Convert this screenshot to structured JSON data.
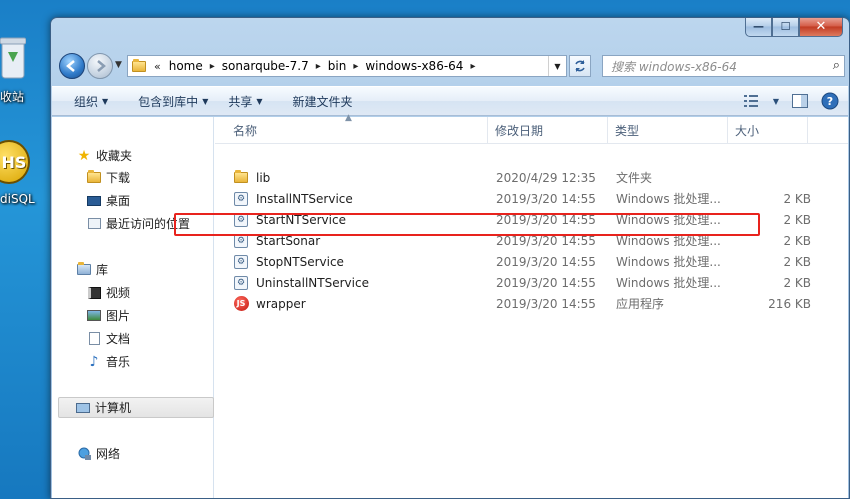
{
  "desktop": {
    "icon1_label": "收站",
    "icon2_label": "diSQL",
    "icon2_badge": "HS"
  },
  "window": {
    "caption_min": "—",
    "caption_max": "☐",
    "caption_close": "✕"
  },
  "address": {
    "crumbs": [
      "home",
      "sonarqube-7.7",
      "bin",
      "windows-x86-64"
    ],
    "chevron": "«"
  },
  "search": {
    "placeholder": "搜索 windows-x86-64"
  },
  "toolbar": {
    "organize": "组织",
    "include_library": "包含到库中",
    "share": "共享",
    "new_folder": "新建文件夹"
  },
  "nav_pane": {
    "favorites": "收藏夹",
    "downloads": "下载",
    "desktop": "桌面",
    "recent": "最近访问的位置",
    "libraries": "库",
    "videos": "视频",
    "pictures": "图片",
    "documents": "文档",
    "music": "音乐",
    "computer": "计算机",
    "network": "网络"
  },
  "columns": {
    "name": "名称",
    "date": "修改日期",
    "type": "类型",
    "size": "大小"
  },
  "files": [
    {
      "name": "lib",
      "date": "2020/4/29 12:35",
      "type": "文件夹",
      "size": "",
      "icon": "folder-icon"
    },
    {
      "name": "InstallNTService",
      "date": "2019/3/20 14:55",
      "type": "Windows 批处理...",
      "size": "2 KB",
      "icon": "batch-file-icon"
    },
    {
      "name": "StartNTService",
      "date": "2019/3/20 14:55",
      "type": "Windows 批处理...",
      "size": "2 KB",
      "icon": "batch-file-icon"
    },
    {
      "name": "StartSonar",
      "date": "2019/3/20 14:55",
      "type": "Windows 批处理...",
      "size": "2 KB",
      "icon": "batch-file-icon"
    },
    {
      "name": "StopNTService",
      "date": "2019/3/20 14:55",
      "type": "Windows 批处理...",
      "size": "2 KB",
      "icon": "batch-file-icon"
    },
    {
      "name": "UninstallNTService",
      "date": "2019/3/20 14:55",
      "type": "Windows 批处理...",
      "size": "2 KB",
      "icon": "batch-file-icon"
    },
    {
      "name": "wrapper",
      "date": "2019/3/20 14:55",
      "type": "应用程序",
      "size": "216 KB",
      "icon": "application-icon"
    }
  ],
  "colors": {
    "highlight": "#e8231d",
    "desktop": "#1a7fc7"
  }
}
